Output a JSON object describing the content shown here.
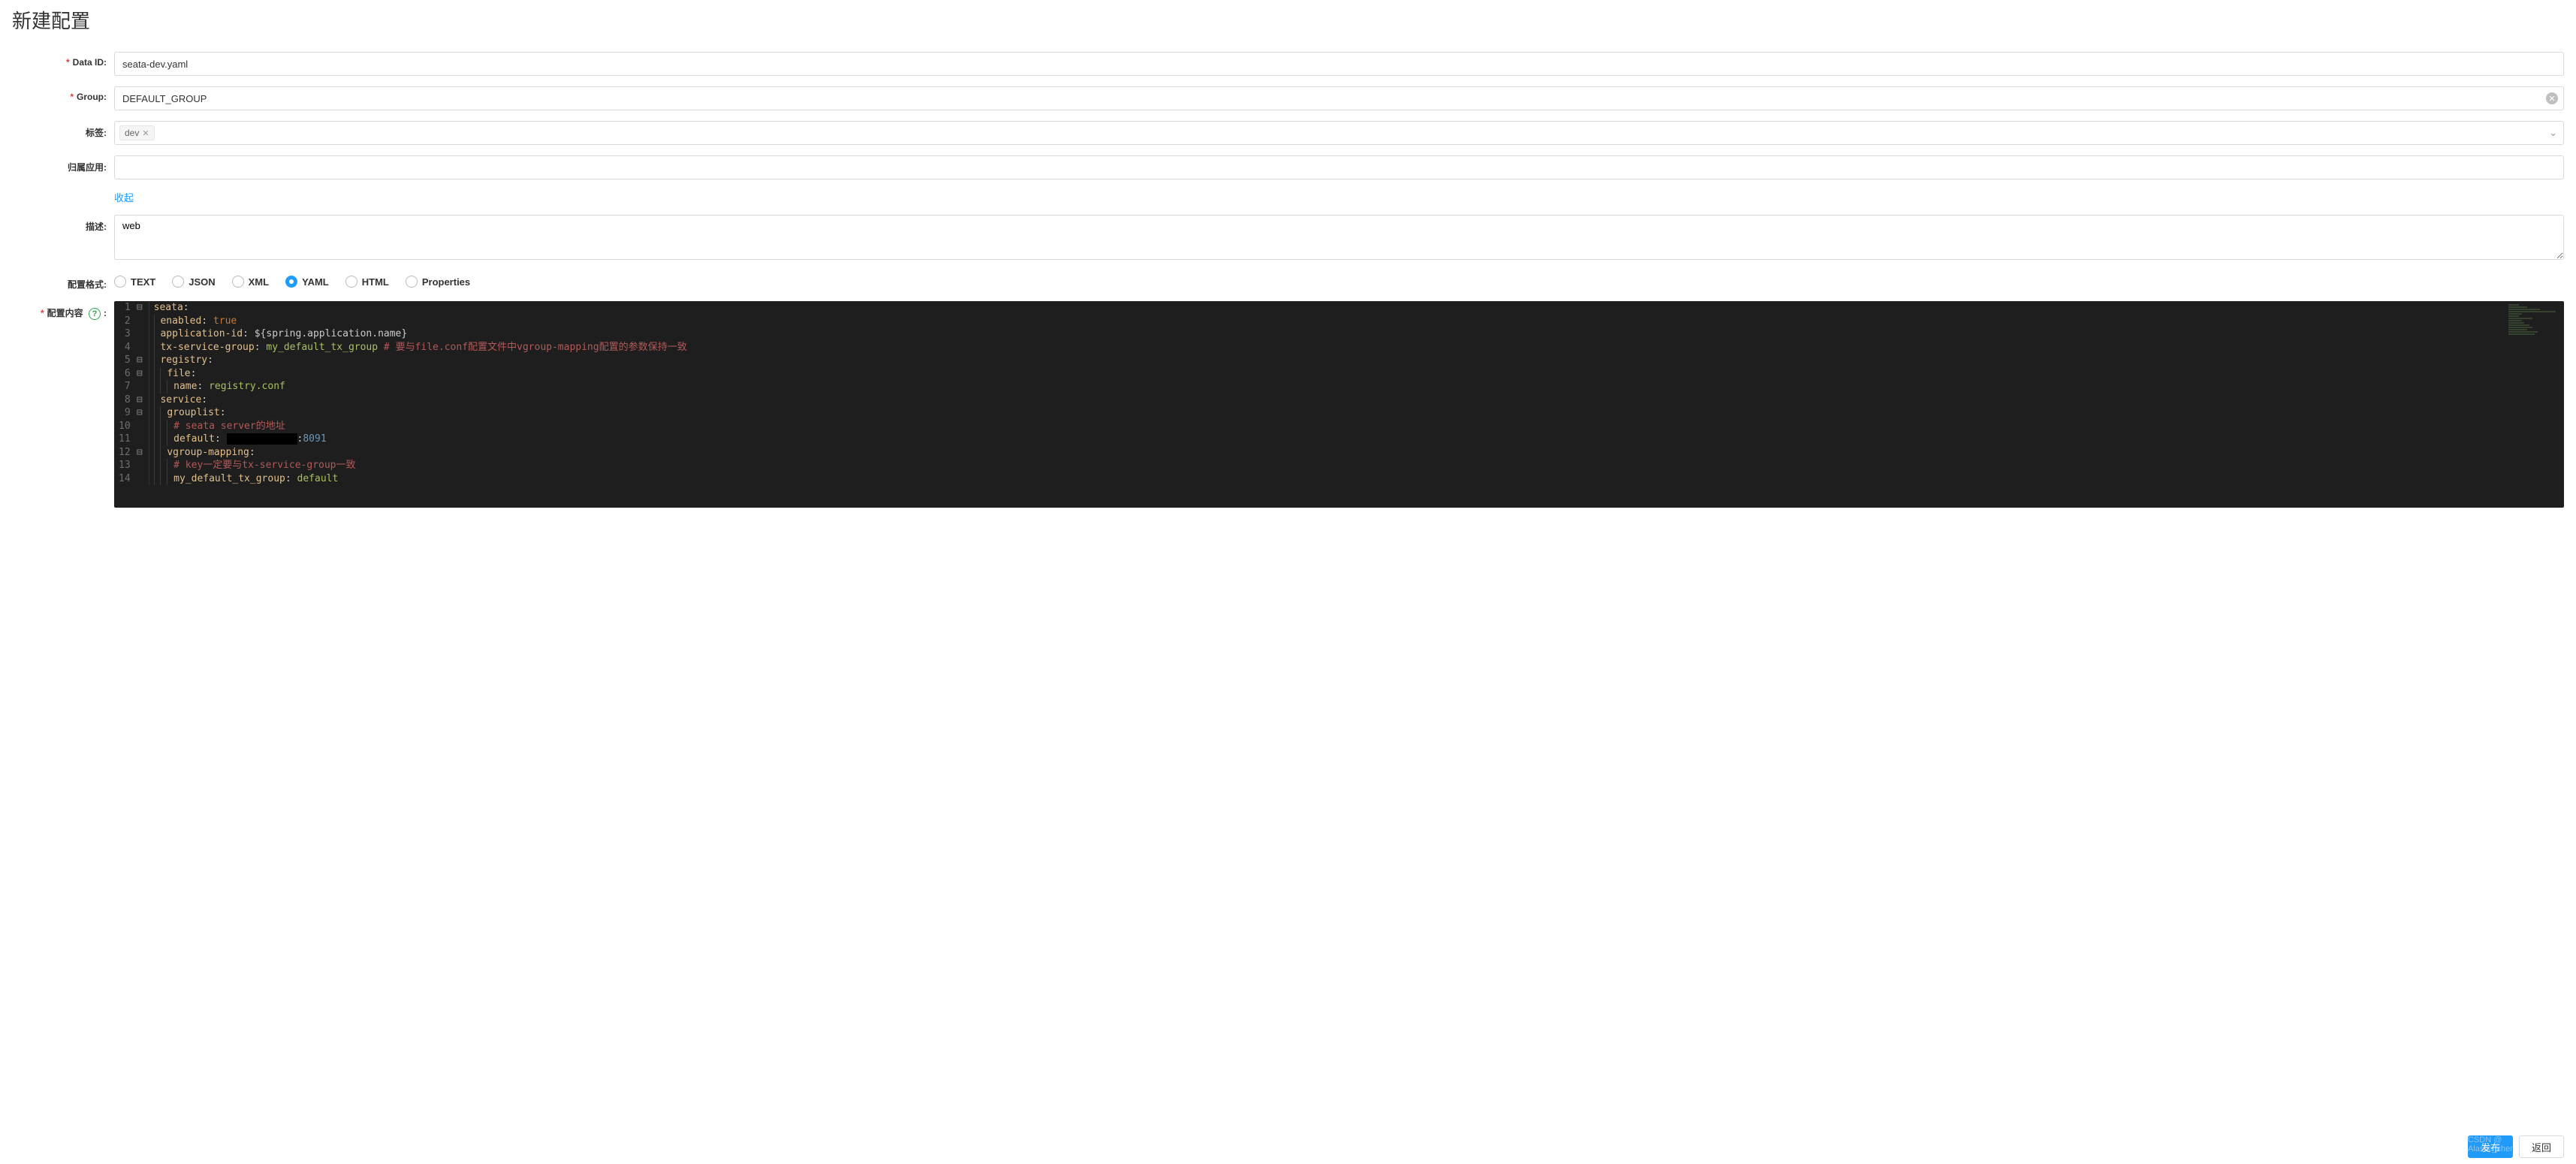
{
  "title": "新建配置",
  "labels": {
    "dataId": "Data ID:",
    "group": "Group:",
    "tags": "标签:",
    "app": "归属应用:",
    "collapse": "收起",
    "description": "描述:",
    "format": "配置格式:",
    "content": "配置内容"
  },
  "values": {
    "dataId": "seata-dev.yaml",
    "group": "DEFAULT_GROUP",
    "tag": "dev",
    "app": "",
    "description": "web"
  },
  "formats": [
    "TEXT",
    "JSON",
    "XML",
    "YAML",
    "HTML",
    "Properties"
  ],
  "formatSelected": "YAML",
  "code": [
    {
      "n": 1,
      "fold": "⊟",
      "indent": 0,
      "tokens": [
        [
          "key",
          "seata"
        ],
        [
          "punc",
          ":"
        ]
      ]
    },
    {
      "n": 2,
      "fold": "",
      "indent": 1,
      "tokens": [
        [
          "key",
          "enabled"
        ],
        [
          "punc",
          ":"
        ],
        [
          "sp",
          " "
        ],
        [
          "bool",
          "true"
        ]
      ]
    },
    {
      "n": 3,
      "fold": "",
      "indent": 1,
      "tokens": [
        [
          "key",
          "application-id"
        ],
        [
          "punc",
          ":"
        ],
        [
          "sp",
          " "
        ],
        [
          "var",
          "${spring.application.name}"
        ]
      ]
    },
    {
      "n": 4,
      "fold": "",
      "indent": 1,
      "tokens": [
        [
          "key",
          "tx-service-group"
        ],
        [
          "punc",
          ":"
        ],
        [
          "sp",
          " "
        ],
        [
          "str",
          "my_default_tx_group"
        ],
        [
          "sp",
          " "
        ],
        [
          "comment",
          "# 要与file.conf配置文件中vgroup-mapping配置的参数保持一致"
        ]
      ]
    },
    {
      "n": 5,
      "fold": "⊟",
      "indent": 1,
      "tokens": [
        [
          "key",
          "registry"
        ],
        [
          "punc",
          ":"
        ]
      ]
    },
    {
      "n": 6,
      "fold": "⊟",
      "indent": 2,
      "tokens": [
        [
          "key",
          "file"
        ],
        [
          "punc",
          ":"
        ]
      ]
    },
    {
      "n": 7,
      "fold": "",
      "indent": 3,
      "tokens": [
        [
          "key",
          "name"
        ],
        [
          "punc",
          ":"
        ],
        [
          "sp",
          " "
        ],
        [
          "str",
          "registry.conf"
        ]
      ]
    },
    {
      "n": 8,
      "fold": "⊟",
      "indent": 1,
      "tokens": [
        [
          "key",
          "service"
        ],
        [
          "punc",
          ":"
        ]
      ]
    },
    {
      "n": 9,
      "fold": "⊟",
      "indent": 2,
      "tokens": [
        [
          "key",
          "grouplist"
        ],
        [
          "punc",
          ":"
        ]
      ]
    },
    {
      "n": 10,
      "fold": "",
      "indent": 3,
      "tokens": [
        [
          "comment",
          "# seata server的地址"
        ]
      ]
    },
    {
      "n": 11,
      "fold": "",
      "indent": 3,
      "tokens": [
        [
          "key",
          "default"
        ],
        [
          "punc",
          ":"
        ],
        [
          "sp",
          " "
        ],
        [
          "redact",
          "            "
        ],
        [
          "punc",
          ":"
        ],
        [
          "num",
          "8091"
        ]
      ]
    },
    {
      "n": 12,
      "fold": "⊟",
      "indent": 2,
      "tokens": [
        [
          "key",
          "vgroup-mapping"
        ],
        [
          "punc",
          ":"
        ]
      ]
    },
    {
      "n": 13,
      "fold": "",
      "indent": 3,
      "tokens": [
        [
          "comment",
          "# key一定要与tx-service-group一致"
        ]
      ]
    },
    {
      "n": 14,
      "fold": "",
      "indent": 3,
      "tokens": [
        [
          "key",
          "my_default_tx_group"
        ],
        [
          "punc",
          ":"
        ],
        [
          "sp",
          " "
        ],
        [
          "str",
          "default"
        ]
      ]
    }
  ],
  "buttons": {
    "publish": "发布",
    "back": "返回"
  },
  "watermark": "CSDN @ Alascc_chen"
}
